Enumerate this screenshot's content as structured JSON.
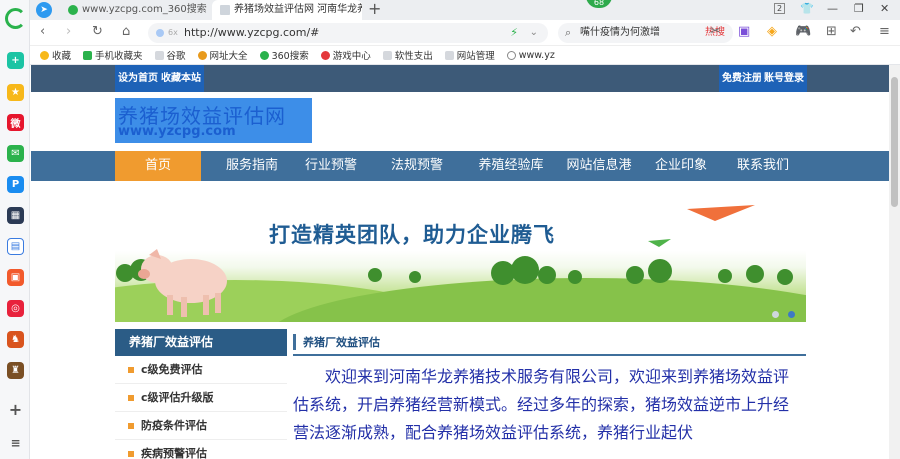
{
  "browser": {
    "tabs": [
      {
        "title": "www.yzcpg.com_360搜索",
        "active": false
      },
      {
        "title": "养猪场效益评估网 河南华龙养猪",
        "active": true
      }
    ],
    "badge": "68",
    "address": "http://www.yzcpg.com/#",
    "security_label": "6x",
    "search_text": "嘴什疫情为何激增",
    "search_hot": "热搜",
    "bookmarks": [
      "收藏",
      "手机收藏夹",
      "谷歌",
      "网址大全",
      "360搜索",
      "游戏中心",
      "软性支出",
      "网站管理",
      "www.yz"
    ]
  },
  "site": {
    "topbar_left": [
      "设为首页",
      "收藏本站"
    ],
    "topbar_right": [
      "免费注册",
      "账号登录"
    ],
    "logo_title": "养猪场效益评估网",
    "logo_subtitle": "www.yzcpg.com",
    "nav": [
      "首页",
      "服务指南",
      "行业预警",
      "法规预警",
      "养殖经验库",
      "网站信息港",
      "企业印象",
      "联系我们"
    ],
    "banner_slogan": "打造精英团队，助力企业腾飞",
    "left_panel": {
      "title": "养猪厂效益评估",
      "items": [
        "c级免费评估",
        "c级评估升级版",
        "防疫条件评估",
        "疾病预警评估"
      ]
    },
    "right_panel": {
      "title": "养猪厂效益评估",
      "text": "欢迎来到河南华龙养猪技术服务有限公司，欢迎来到养猪场效益评估系统，开启养猪经营新模式。经过多年的探索，猪场效益逆市上升经营法逐渐成熟，配合养猪场效益评估系统，养猪行业起伏"
    }
  },
  "colors": {
    "topbar": "#3d5a78",
    "nav": "#3f6f9b",
    "nav_active": "#f09b2f",
    "article_text": "#2330a8"
  }
}
